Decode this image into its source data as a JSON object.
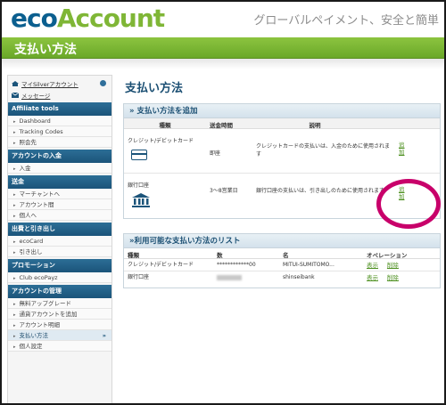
{
  "header": {
    "logo_eco": "eco",
    "logo_account": "Account",
    "tagline": "グローバルペイメント、安全と簡単",
    "page_bar_title": "支払い方法"
  },
  "sidebar": {
    "top_links": [
      {
        "label": "マイSilverアカウント",
        "icon": "home-icon"
      },
      {
        "label": "メッセージ",
        "icon": "mail-icon"
      }
    ],
    "sections": [
      {
        "title": "Affiliate tools",
        "items": [
          "Dashboard",
          "Tracking Codes",
          "照会先"
        ]
      },
      {
        "title": "アカウントの入金",
        "items": [
          "入金"
        ]
      },
      {
        "title": "送金",
        "items": [
          "マーチャントへ",
          "アカウント間",
          "個人へ"
        ]
      },
      {
        "title": "出費と引き出し",
        "items": [
          "ecoCard",
          "引き出し"
        ]
      },
      {
        "title": "プロモーション",
        "items": [
          "Club ecoPayz"
        ]
      },
      {
        "title": "アカウントの管理",
        "items": [
          "無料アップグレード",
          "通貨アカウントを追加",
          "アカウント明細",
          "支払い方法",
          "個人設定"
        ]
      }
    ],
    "active_item": "支払い方法"
  },
  "main": {
    "title": "支払い方法",
    "add_panel": {
      "heading": "» 支払い方法を追加",
      "columns": [
        "種類",
        "送金時間",
        "説明"
      ],
      "rows": [
        {
          "type": "クレジット/デビットカード",
          "icon": "credit-card-icon",
          "time": "即座",
          "description": "クレジットカードの支払いは、入金のために使用されます",
          "action": "追加"
        },
        {
          "type": "銀行口座",
          "icon": "bank-icon",
          "time": "3～8営業日",
          "description": "銀行口座の支払いは、引き出しのために使用されます",
          "action": "追加"
        }
      ]
    },
    "list_panel": {
      "heading": "»利用可能な支払い方法のリスト",
      "columns": [
        "種類",
        "数",
        "名",
        "オペレーション"
      ],
      "rows": [
        {
          "type": "クレジット/デビットカード",
          "number": "************00",
          "name": "MITUI-SUMITOMO...",
          "view": "表示",
          "delete": "削除"
        },
        {
          "type": "銀行口座",
          "number": "",
          "name": "shinseibank",
          "view": "表示",
          "delete": "削除"
        }
      ]
    }
  },
  "colors": {
    "accent_green": "#7fb636",
    "brand_blue": "#0b5f8f",
    "highlight_circle": "#c8006a"
  }
}
